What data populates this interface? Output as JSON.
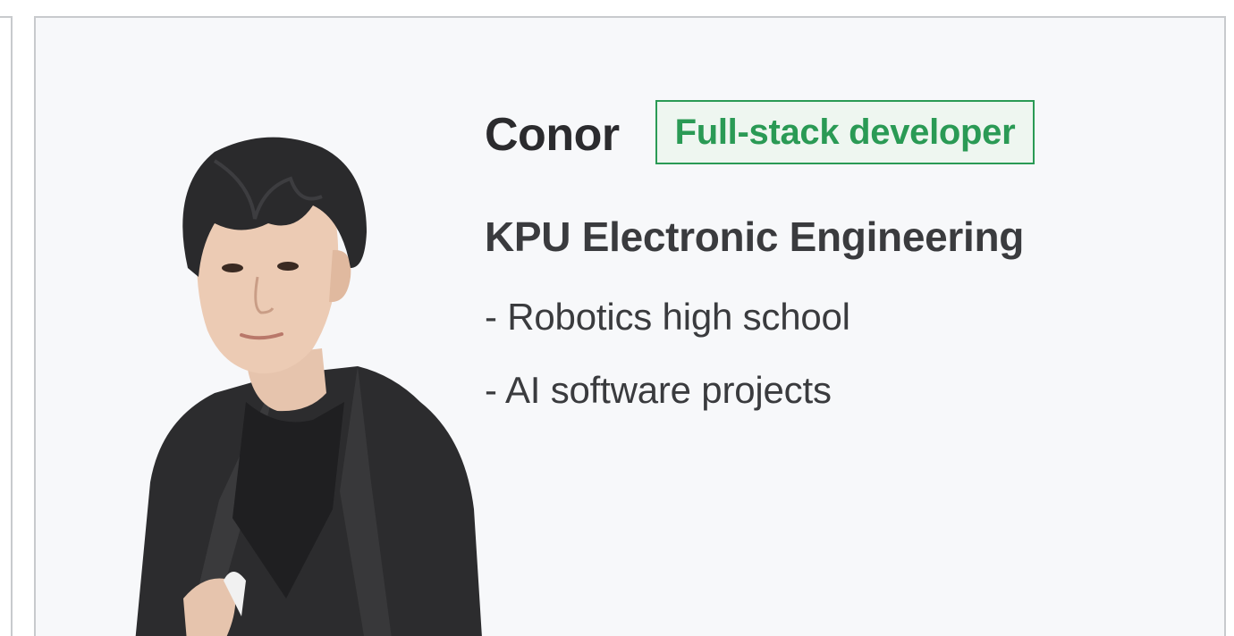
{
  "profile": {
    "name": "Conor",
    "role": "Full-stack developer",
    "school": "KPU Electronic Engineering",
    "highlights": [
      {
        "text": "- Robotics high school"
      },
      {
        "text": "- AI software projects"
      }
    ]
  },
  "colors": {
    "accent": "#2a9a55",
    "accent_bg": "#eef6f0",
    "card_bg": "#f7f8fa",
    "border": "#c8cacd",
    "text_primary": "#2b2b2e",
    "text_secondary": "#3a3b3e"
  },
  "icons": {
    "portrait": "person-portrait-photo"
  }
}
